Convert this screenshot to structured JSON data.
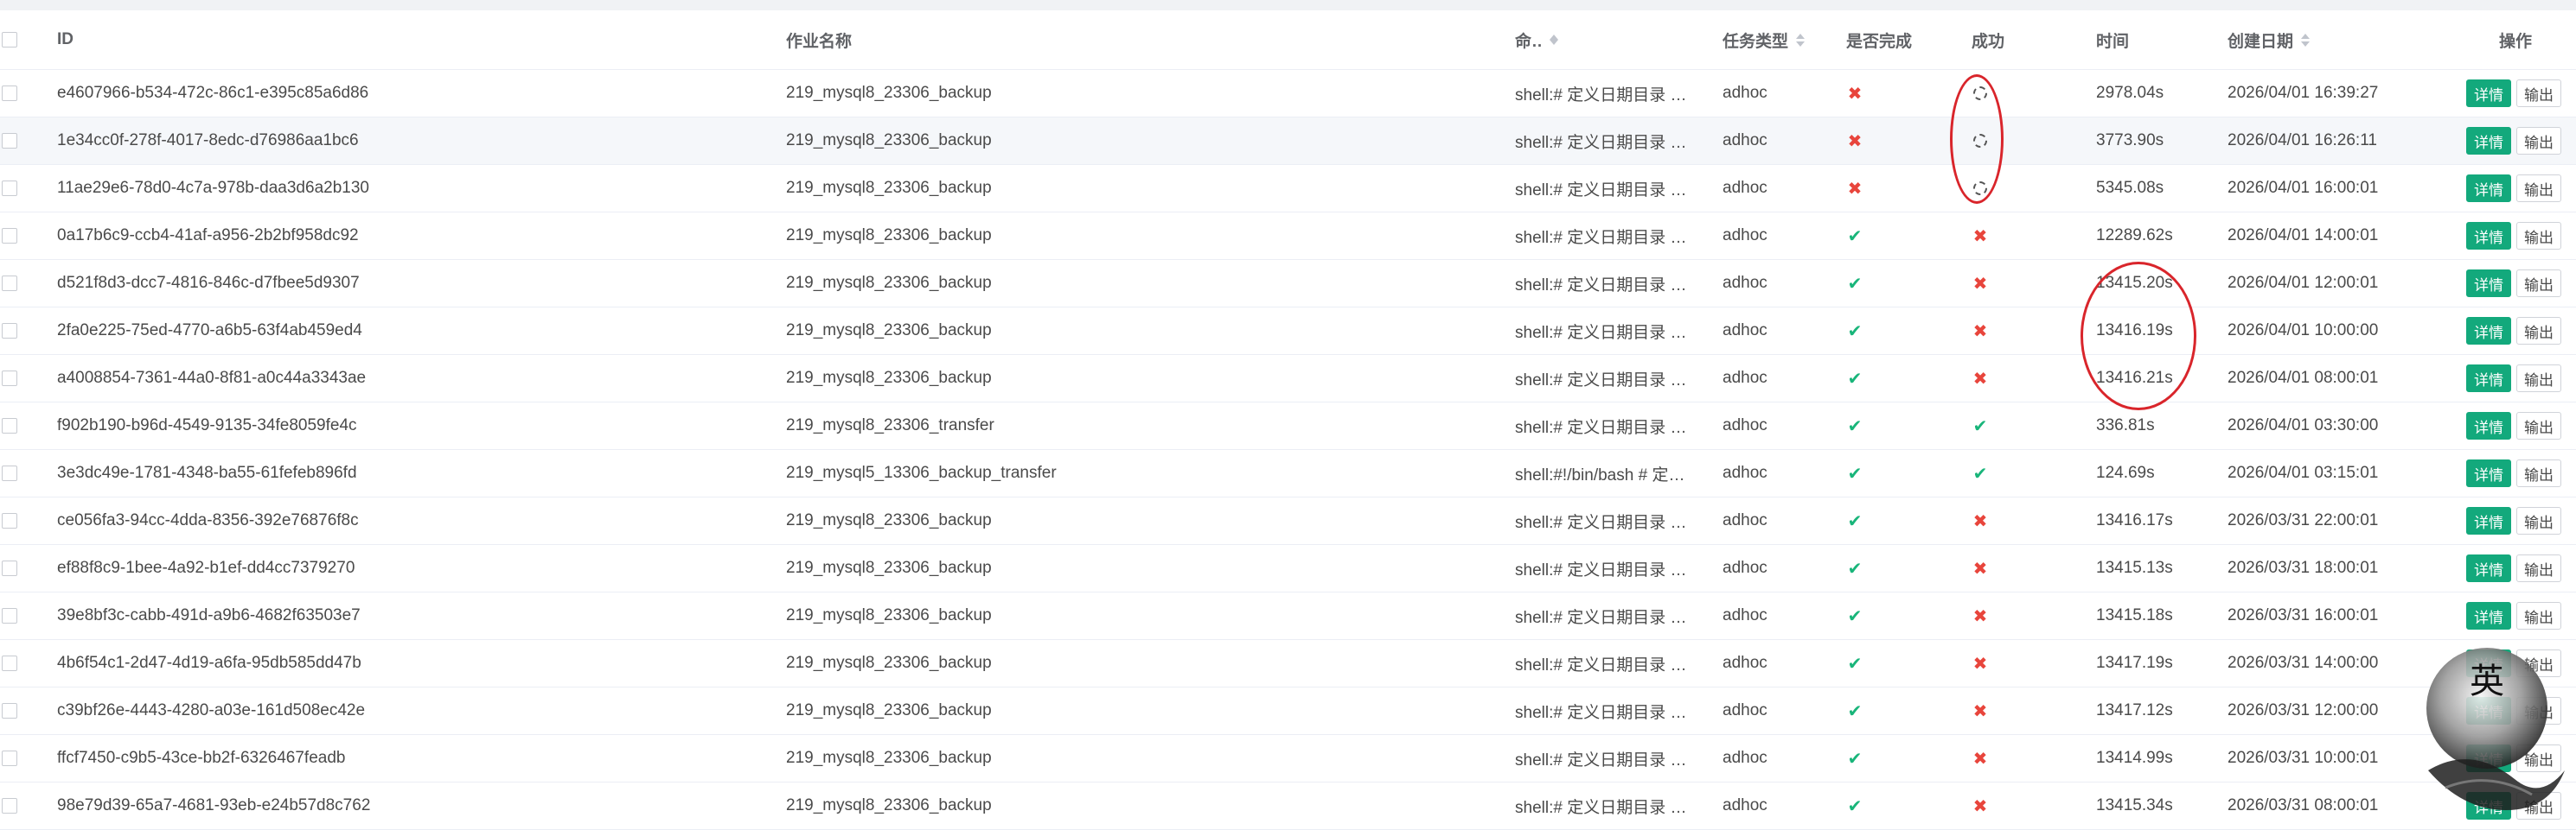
{
  "table": {
    "headers": {
      "id": "ID",
      "name": "作业名称",
      "command": "命令",
      "type": "任务类型",
      "done": "是否完成",
      "success": "成功",
      "time": "时间",
      "date": "创建日期",
      "ops": "操作"
    },
    "actions": {
      "detail": "详情",
      "output": "输出"
    },
    "rows": [
      {
        "id": "e4607966-b534-472c-86c1-e395c85a6d86",
        "name": "219_mysql8_23306_backup",
        "cmd": "shell:# 定义日期目录 DATE_DIR=$(date",
        "type": "adhoc",
        "done": "fail",
        "success": "running",
        "time": "2978.04s",
        "date": "2026/04/01 16:39:27"
      },
      {
        "id": "1e34cc0f-278f-4017-8edc-d76986aa1bc6",
        "name": "219_mysql8_23306_backup",
        "cmd": "shell:# 定义日期目录 DATE_DIR=$(date",
        "type": "adhoc",
        "done": "fail",
        "success": "running",
        "time": "3773.90s",
        "date": "2026/04/01 16:26:11"
      },
      {
        "id": "11ae29e6-78d0-4c7a-978b-daa3d6a2b130",
        "name": "219_mysql8_23306_backup",
        "cmd": "shell:# 定义日期目录 DATE_DIR=$(date",
        "type": "adhoc",
        "done": "fail",
        "success": "running",
        "time": "5345.08s",
        "date": "2026/04/01 16:00:01"
      },
      {
        "id": "0a17b6c9-ccb4-41af-a956-2b2bf958dc92",
        "name": "219_mysql8_23306_backup",
        "cmd": "shell:# 定义日期目录 DATE_DIR=$(date",
        "type": "adhoc",
        "done": "ok",
        "success": "fail",
        "time": "12289.62s",
        "date": "2026/04/01 14:00:01"
      },
      {
        "id": "d521f8d3-dcc7-4816-846c-d7fbee5d9307",
        "name": "219_mysql8_23306_backup",
        "cmd": "shell:# 定义日期目录 DATE_DIR=$(date",
        "type": "adhoc",
        "done": "ok",
        "success": "fail",
        "time": "13415.20s",
        "date": "2026/04/01 12:00:01"
      },
      {
        "id": "2fa0e225-75ed-4770-a6b5-63f4ab459ed4",
        "name": "219_mysql8_23306_backup",
        "cmd": "shell:# 定义日期目录 DATE_DIR=$(date",
        "type": "adhoc",
        "done": "ok",
        "success": "fail",
        "time": "13416.19s",
        "date": "2026/04/01 10:00:00"
      },
      {
        "id": "a4008854-7361-44a0-8f81-a0c44a3343ae",
        "name": "219_mysql8_23306_backup",
        "cmd": "shell:# 定义日期目录 DATE_DIR=$(date",
        "type": "adhoc",
        "done": "ok",
        "success": "fail",
        "time": "13416.21s",
        "date": "2026/04/01 08:00:01"
      },
      {
        "id": "f902b190-b96d-4549-9135-34fe8059fe4c",
        "name": "219_mysql8_23306_transfer",
        "cmd": "shell:# 定义日期目录 DATE_DIR=$(date",
        "type": "adhoc",
        "done": "ok",
        "success": "ok",
        "time": "336.81s",
        "date": "2026/04/01 03:30:00"
      },
      {
        "id": "3e3dc49e-1781-4348-ba55-61fefeb896fd",
        "name": "219_mysql5_13306_backup_transfer",
        "cmd": "shell:#!/bin/bash # 定义日期目录",
        "type": "adhoc",
        "done": "ok",
        "success": "ok",
        "time": "124.69s",
        "date": "2026/04/01 03:15:01"
      },
      {
        "id": "ce056fa3-94cc-4dda-8356-392e76876f8c",
        "name": "219_mysql8_23306_backup",
        "cmd": "shell:# 定义日期目录 DATE_DIR=$(date",
        "type": "adhoc",
        "done": "ok",
        "success": "fail",
        "time": "13416.17s",
        "date": "2026/03/31 22:00:01"
      },
      {
        "id": "ef88f8c9-1bee-4a92-b1ef-dd4cc7379270",
        "name": "219_mysql8_23306_backup",
        "cmd": "shell:# 定义日期目录 DATE_DIR=$(date",
        "type": "adhoc",
        "done": "ok",
        "success": "fail",
        "time": "13415.13s",
        "date": "2026/03/31 18:00:01"
      },
      {
        "id": "39e8bf3c-cabb-491d-a9b6-4682f63503e7",
        "name": "219_mysql8_23306_backup",
        "cmd": "shell:# 定义日期目录 DATE_DIR=$(date",
        "type": "adhoc",
        "done": "ok",
        "success": "fail",
        "time": "13415.18s",
        "date": "2026/03/31 16:00:01"
      },
      {
        "id": "4b6f54c1-2d47-4d19-a6fa-95db585dd47b",
        "name": "219_mysql8_23306_backup",
        "cmd": "shell:# 定义日期目录 DATE_DIR=$(date",
        "type": "adhoc",
        "done": "ok",
        "success": "fail",
        "time": "13417.19s",
        "date": "2026/03/31 14:00:00"
      },
      {
        "id": "c39bf26e-4443-4280-a03e-161d508ec42e",
        "name": "219_mysql8_23306_backup",
        "cmd": "shell:# 定义日期目录 DATE_DIR=$(date",
        "type": "adhoc",
        "done": "ok",
        "success": "fail",
        "time": "13417.12s",
        "date": "2026/03/31 12:00:00"
      },
      {
        "id": "ffcf7450-c9b5-43ce-bb2f-6326467feadb",
        "name": "219_mysql8_23306_backup",
        "cmd": "shell:# 定义日期目录 DATE_DIR=$(date",
        "type": "adhoc",
        "done": "ok",
        "success": "fail",
        "time": "13414.99s",
        "date": "2026/03/31 10:00:01"
      },
      {
        "id": "98e79d39-65a7-4681-93eb-e24b57d8c762",
        "name": "219_mysql8_23306_backup",
        "cmd": "shell:# 定义日期目录 DATE_DIR=$(date",
        "type": "adhoc",
        "done": "ok",
        "success": "fail",
        "time": "13415.34s",
        "date": "2026/03/31 08:00:01"
      }
    ]
  },
  "overlay": {
    "seal_char": "英"
  },
  "icons": {
    "ok": "check-icon",
    "fail": "cross-icon",
    "running": "loading-spinner-icon",
    "sort": "sort-caret-icon"
  },
  "colors": {
    "primary": "#13a97c",
    "danger": "#e8453c",
    "annotation": "#d9252b"
  }
}
